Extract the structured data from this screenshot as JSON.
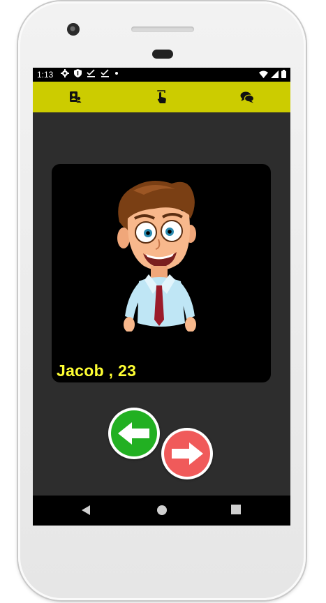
{
  "status_bar": {
    "time": "1:13",
    "notification_icons": [
      "gear-icon",
      "shield-icon",
      "check-icon",
      "check-icon",
      "dot-icon"
    ],
    "system_icons": [
      "wifi-icon",
      "signal-icon",
      "battery-icon"
    ]
  },
  "toolbar": {
    "items": [
      {
        "icon": "profile-card-icon"
      },
      {
        "icon": "tap-hand-icon"
      },
      {
        "icon": "chat-bubbles-icon"
      }
    ],
    "color": "#cccc00"
  },
  "profile": {
    "name_age": "Jacob , 23",
    "name_color": "#ffff33"
  },
  "actions": {
    "reject": {
      "icon": "left-arrow-icon",
      "color": "#22b022"
    },
    "like": {
      "icon": "right-arrow-icon",
      "color": "#f05a5a"
    }
  },
  "navigation": {
    "items": [
      "back-icon",
      "home-icon",
      "recents-icon"
    ]
  }
}
